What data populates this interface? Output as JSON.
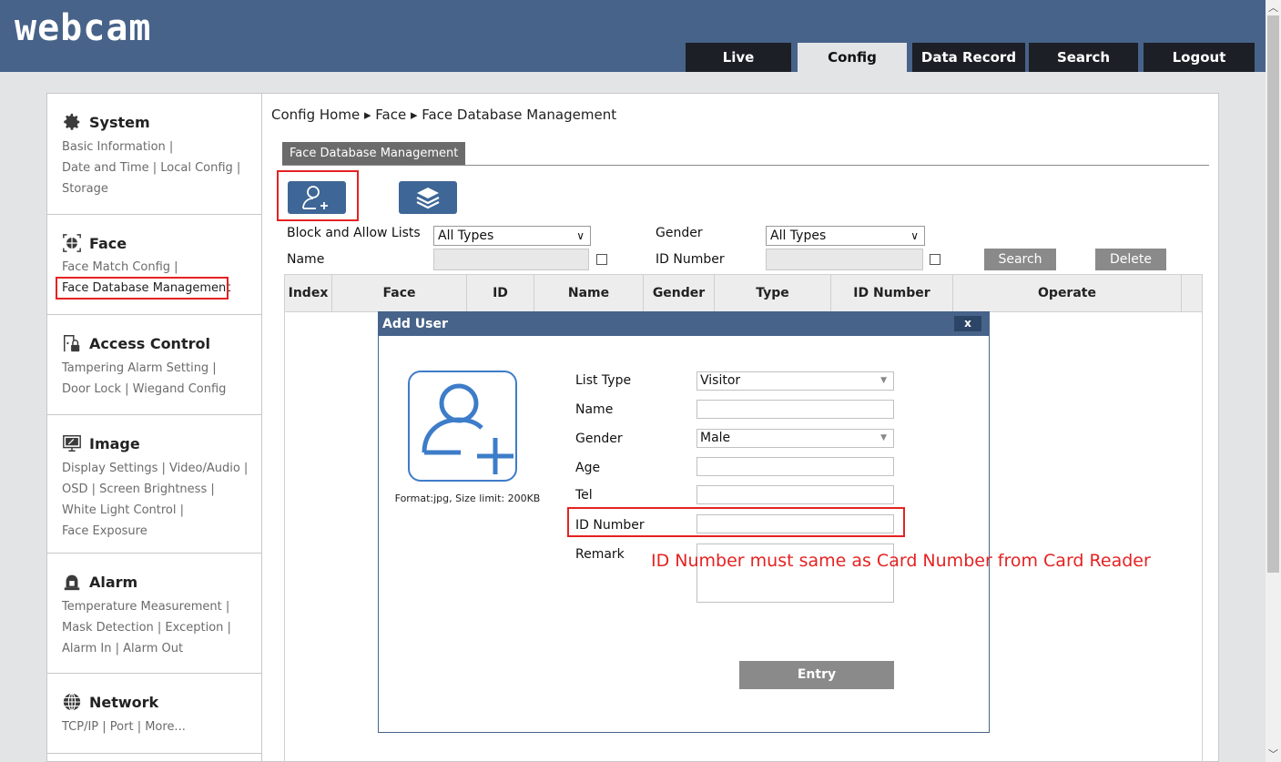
{
  "header": {
    "logo": "webcam",
    "tabs": [
      {
        "label": "Live",
        "active": false
      },
      {
        "label": "Config",
        "active": true
      },
      {
        "label": "Data Record",
        "active": false
      },
      {
        "label": "Search",
        "active": false
      },
      {
        "label": "Logout",
        "active": false
      }
    ]
  },
  "sidebar": {
    "sections": [
      {
        "title": "System",
        "icon": "gear-icon",
        "links": [
          "Basic Information |",
          "Date and Time | Local Config |",
          "Storage"
        ]
      },
      {
        "title": "Face",
        "icon": "face-scan-icon",
        "links": [
          "Face Match Config |",
          "Face Database Management"
        ]
      },
      {
        "title": "Access Control",
        "icon": "door-lock-icon",
        "links": [
          "Tampering Alarm Setting |",
          "Door Lock | Wiegand Config"
        ]
      },
      {
        "title": "Image",
        "icon": "monitor-icon",
        "links": [
          "Display Settings | Video/Audio |",
          "OSD | Screen Brightness |",
          "White Light Control |",
          "Face Exposure"
        ]
      },
      {
        "title": "Alarm",
        "icon": "alarm-bell-icon",
        "links": [
          "Temperature Measurement |",
          "Mask Detection | Exception |",
          "Alarm In | Alarm Out"
        ]
      },
      {
        "title": "Network",
        "icon": "globe-icon",
        "links": [
          "TCP/IP | Port | More..."
        ]
      }
    ]
  },
  "main": {
    "breadcrumb": "Config Home ▸ Face ▸ Face Database Management",
    "tab": "Face Database Management",
    "toolbar": {
      "add_user_icon": "add-user-icon",
      "layers_icon": "layers-icon"
    },
    "filters": {
      "list_label": "Block and Allow Lists",
      "list_value": "All Types",
      "gender_label": "Gender",
      "gender_value": "All Types",
      "name_label": "Name",
      "id_label": "ID Number",
      "search_button": "Search",
      "delete_button": "Delete"
    },
    "table": {
      "columns": [
        "Index",
        "Face",
        "ID",
        "Name",
        "Gender",
        "Type",
        "ID Number",
        "Operate"
      ]
    }
  },
  "dialog": {
    "title": "Add User",
    "close": "x",
    "format_note": "Format:jpg, Size limit: 200KB",
    "fields": {
      "list_type_label": "List Type",
      "list_type_value": "Visitor",
      "name_label": "Name",
      "gender_label": "Gender",
      "gender_value": "Male",
      "age_label": "Age",
      "tel_label": "Tel",
      "id_number_label": "ID Number",
      "remark_label": "Remark"
    },
    "entry_button": "Entry"
  },
  "annotation": "ID Number must same as Card Number from Card Reader",
  "colors": {
    "header": "#476389",
    "accent_button": "#3e6696",
    "highlight": "#e52222",
    "avatar": "#3d7cc9"
  }
}
